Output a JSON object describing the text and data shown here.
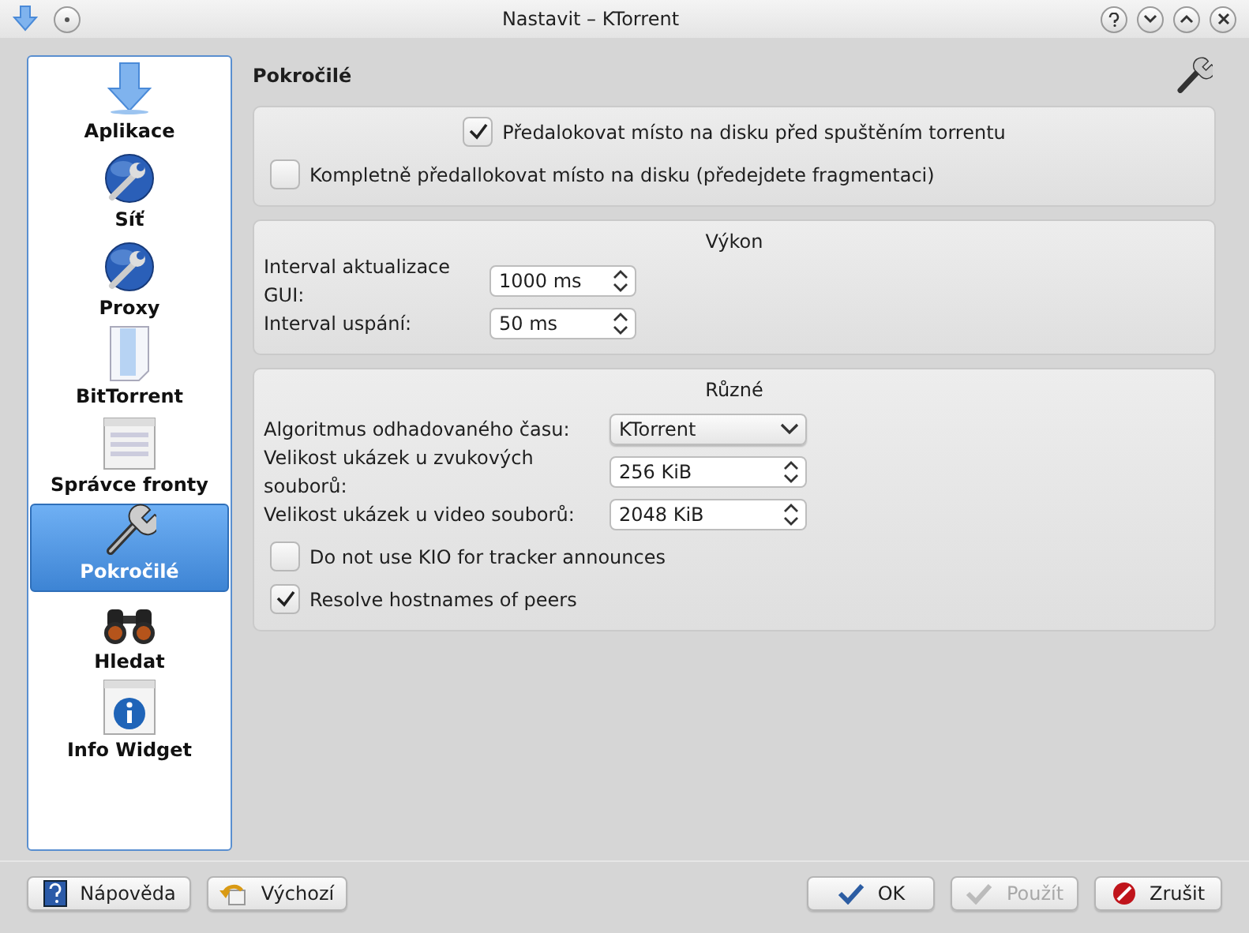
{
  "window": {
    "title": "Nastavit – KTorrent"
  },
  "sidebar": {
    "items": [
      {
        "label": "Aplikace",
        "kind": "download",
        "selected": false
      },
      {
        "label": "Síť",
        "kind": "globe",
        "selected": false
      },
      {
        "label": "Proxy",
        "kind": "globe",
        "selected": false
      },
      {
        "label": "BitTorrent",
        "kind": "document",
        "selected": false
      },
      {
        "label": "Správce fronty",
        "kind": "list",
        "selected": false
      },
      {
        "label": "Pokročilé",
        "kind": "wrench",
        "selected": true
      },
      {
        "label": "Hledat",
        "kind": "binoculars",
        "selected": false
      },
      {
        "label": "Info Widget",
        "kind": "info",
        "selected": false
      }
    ]
  },
  "page": {
    "title": "Pokročilé"
  },
  "groups": [
    {
      "rows": [
        {
          "kind": "checkbox",
          "label": "Předalokovat místo na disku před spuštěním torrentu",
          "checked": true
        },
        {
          "kind": "checkbox",
          "label": "Kompletně předallokovat místo na disku (předejdete fragmentaci)",
          "checked": false
        }
      ]
    },
    {
      "title": "Výkon",
      "rows": [
        {
          "kind": "spin",
          "label": "Interval aktualizace GUI:",
          "value": "1000 ms"
        },
        {
          "kind": "spin",
          "label": "Interval uspání:",
          "value": "50 ms"
        }
      ]
    },
    {
      "title": "Různé",
      "rows": [
        {
          "kind": "combo",
          "label": "Algoritmus odhadovaného času:",
          "value": "KTorrent"
        },
        {
          "kind": "spin",
          "label": "Velikost ukázek u zvukových souborů:",
          "value": "256 KiB"
        },
        {
          "kind": "spin",
          "label": "Velikost ukázek u video souborů:",
          "value": "2048 KiB"
        },
        {
          "kind": "checkbox",
          "label": "Do not use KIO for tracker announces",
          "checked": false
        },
        {
          "kind": "checkbox",
          "label": "Resolve hostnames of peers",
          "checked": true
        }
      ]
    }
  ],
  "buttons_left": [
    {
      "label": "Nápověda",
      "kind": "help",
      "disabled": false
    },
    {
      "label": "Výchozí",
      "kind": "undo",
      "disabled": false
    }
  ],
  "buttons_right": [
    {
      "label": "OK",
      "kind": "ok",
      "disabled": false
    },
    {
      "label": "Použít",
      "kind": "apply",
      "disabled": true
    },
    {
      "label": "Zrušit",
      "kind": "cancel",
      "disabled": false
    }
  ]
}
